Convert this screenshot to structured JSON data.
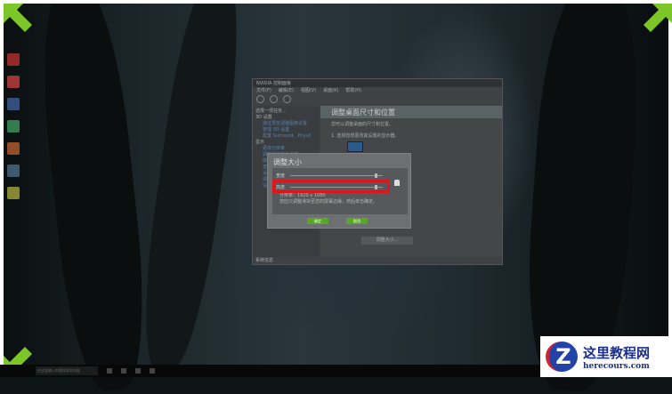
{
  "control_panel": {
    "title": "NVIDIA 控制面板",
    "menu": [
      "文件(F)",
      "编辑(E)",
      "视图(V)",
      "桌面(K)",
      "帮助(H)"
    ],
    "side": {
      "task_label": "选择一项任务...",
      "groups": [
        {
          "label": "3D 设置",
          "items": [
            "通过预览调整图像设置",
            "管理 3D 设置",
            "配置 Surround、PhysX"
          ]
        },
        {
          "label": "显示",
          "items": [
            "更改分辨率",
            "调整桌面颜色设置",
            "旋转显示器",
            "查看 HDCP 状态",
            "设置数字音频",
            "调整桌面尺寸和位置",
            "设置多个显示器"
          ]
        }
      ]
    },
    "header": "调整桌面尺寸和位置",
    "subtitle": "您可以调整桌面的尺寸和位置。",
    "step1": "1. 选择您想更改其设置的显示器。",
    "resize_button": "调整大小...",
    "status": "系统信息"
  },
  "dialog": {
    "title": "调整大小",
    "width_label": "宽度",
    "height_label": "高度",
    "info_line1": "分辨率：1920 x 1080",
    "info_line2": "您应只调整滑块至您的屏幕边缘，然后单击确定。",
    "ok": "确定",
    "cancel": "取消"
  },
  "taskbar": {
    "search_placeholder": "在这里输入你要搜索的内容"
  },
  "watermark": {
    "brand": "这里教程网",
    "url": "herecours.com",
    "letter": "Z"
  },
  "colors": {
    "accent_green": "#5aa626",
    "highlight_red": "#e0141c",
    "arrow_green": "#7cc628"
  }
}
